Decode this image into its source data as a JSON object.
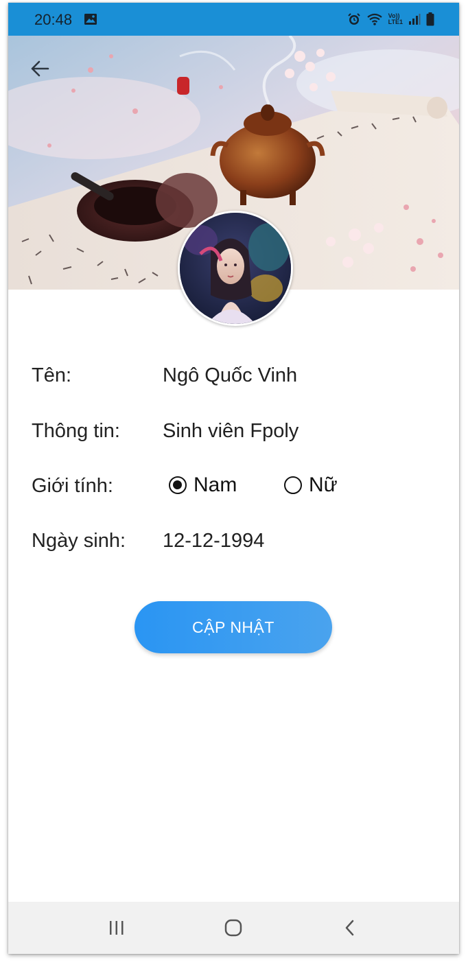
{
  "status_bar": {
    "time": "20:48",
    "gallery_icon": "image-icon",
    "alarm_icon": "alarm-icon",
    "wifi_icon": "wifi-icon",
    "network_top": "Vo))",
    "network_bottom": "LTE1",
    "signal_icon": "signal-icon",
    "battery_icon": "battery-icon"
  },
  "header": {
    "back_icon": "arrow-left-icon"
  },
  "profile": {
    "name_label": "Tên:",
    "name_value": "Ngô Quốc Vinh",
    "info_label": "Thông tin:",
    "info_value": "Sinh viên Fpoly",
    "gender_label": "Giới tính:",
    "gender_options": [
      {
        "label": "Nam",
        "checked": true
      },
      {
        "label": "Nữ",
        "checked": false
      }
    ],
    "birth_label": "Ngày sinh:",
    "birth_value": "12-12-1994"
  },
  "actions": {
    "update_label": "CẬP NHẬT"
  },
  "nav_bar": {
    "recent_icon": "recent-apps-icon",
    "home_icon": "home-icon",
    "back_icon": "chevron-left-icon"
  },
  "colors": {
    "status_bar": "#1a8fd6",
    "button": "#2a95f3",
    "nav_bar": "#f1f1f1"
  }
}
